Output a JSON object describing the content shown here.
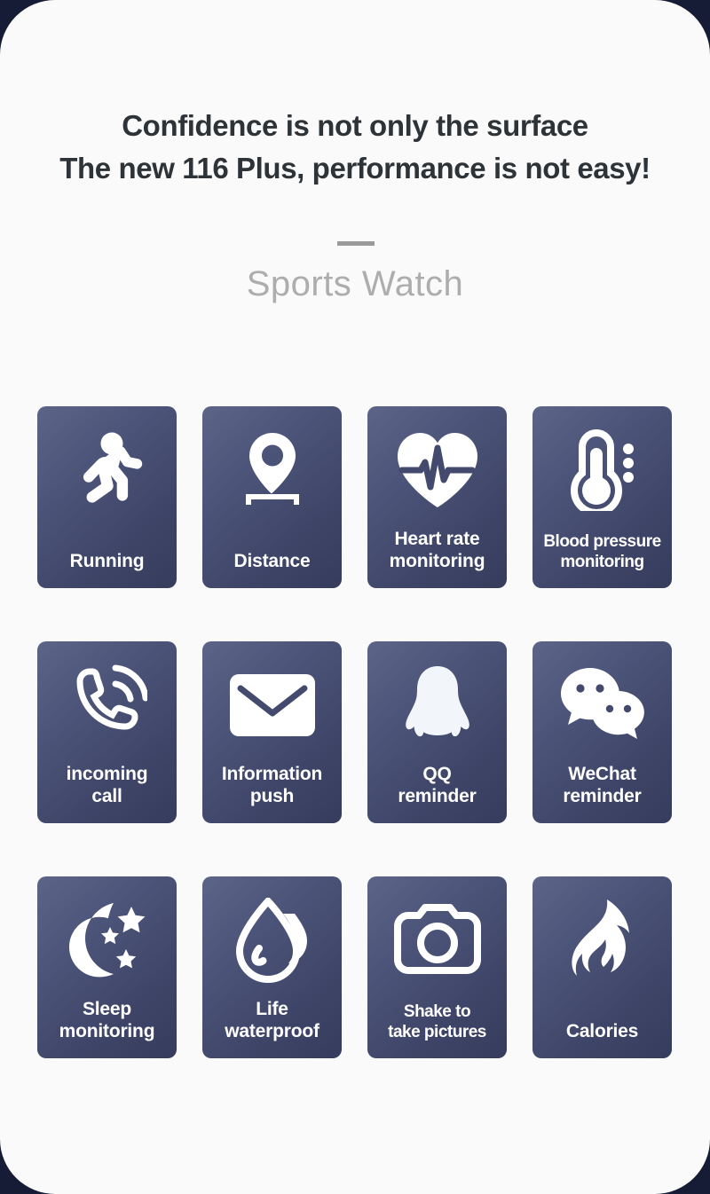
{
  "theme": {
    "page_background": "#161c35",
    "card_background": "#fafafa",
    "headline_color": "#2e3338",
    "subtitle_color": "#adadad",
    "tile_gradient_start": "#5c6488",
    "tile_gradient_end": "#363c5c",
    "tile_label_color": "#ffffff",
    "divider_color": "#9a9a9a"
  },
  "header": {
    "headline_line1": "Confidence is not only the surface",
    "headline_line2": "The new 116 Plus, performance is not easy!",
    "subtitle": "Sports Watch"
  },
  "features": [
    {
      "icon": "running-icon",
      "label_line1": "Running",
      "label_line2": ""
    },
    {
      "icon": "map-pin-icon",
      "label_line1": "Distance",
      "label_line2": ""
    },
    {
      "icon": "heart-rate-icon",
      "label_line1": "Heart rate",
      "label_line2": "monitoring"
    },
    {
      "icon": "thermometer-icon",
      "label_line1": "Blood pressure",
      "label_line2": "monitoring"
    },
    {
      "icon": "phone-ringing-icon",
      "label_line1": "incoming",
      "label_line2": "call"
    },
    {
      "icon": "envelope-icon",
      "label_line1": "Information",
      "label_line2": "push"
    },
    {
      "icon": "qq-penguin-icon",
      "label_line1": "QQ",
      "label_line2": "reminder"
    },
    {
      "icon": "wechat-bubbles-icon",
      "label_line1": "WeChat",
      "label_line2": "reminder"
    },
    {
      "icon": "moon-stars-icon",
      "label_line1": "Sleep",
      "label_line2": "monitoring"
    },
    {
      "icon": "water-drop-icon",
      "label_line1": "Life",
      "label_line2": "waterproof"
    },
    {
      "icon": "camera-icon",
      "label_line1": "Shake to",
      "label_line2": "take pictures"
    },
    {
      "icon": "flame-icon",
      "label_line1": "Calories",
      "label_line2": ""
    }
  ]
}
